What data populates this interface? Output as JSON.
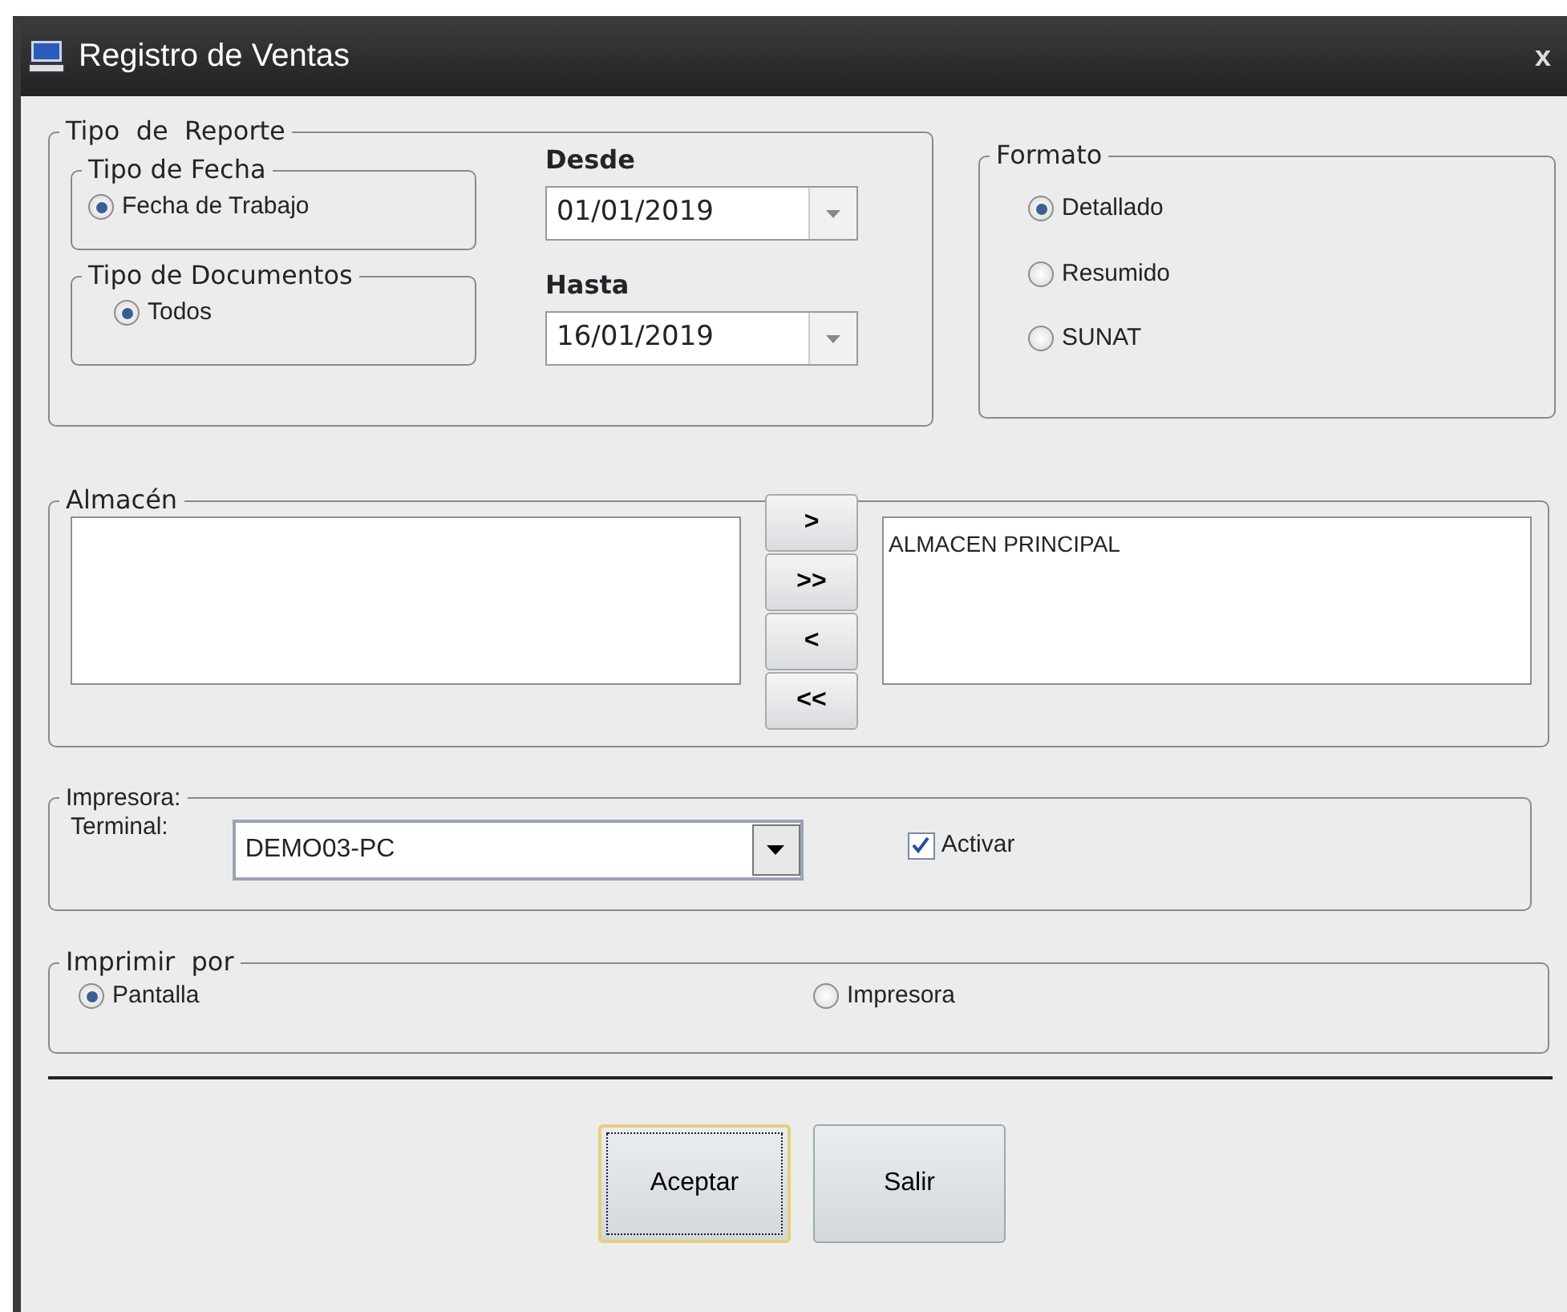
{
  "window": {
    "title": "Registro de Ventas",
    "close": "x"
  },
  "tipo_reporte": {
    "title": "Tipo  de  Reporte",
    "tipo_fecha": {
      "title": "Tipo de Fecha",
      "options": [
        {
          "label": "Fecha de Trabajo",
          "selected": true
        }
      ]
    },
    "tipo_documentos": {
      "title": "Tipo de Documentos",
      "options": [
        {
          "label": "Todos",
          "selected": true
        }
      ]
    },
    "desde": {
      "label": "Desde",
      "value": "01/01/2019"
    },
    "hasta": {
      "label": "Hasta",
      "value": "16/01/2019"
    }
  },
  "formato": {
    "title": "Formato",
    "options": [
      {
        "label": "Detallado",
        "selected": true
      },
      {
        "label": "Resumido",
        "selected": false
      },
      {
        "label": "SUNAT",
        "selected": false
      }
    ]
  },
  "almacen": {
    "title": "Almacén",
    "selected_items": [
      "ALMACEN PRINCIPAL"
    ],
    "buttons": [
      ">",
      ">>",
      "<",
      "<<"
    ]
  },
  "impresora": {
    "title": "Impresora:",
    "terminal_label": "Terminal:",
    "terminal_value": "DEMO03-PC",
    "activar": {
      "label": "Activar",
      "checked": true
    }
  },
  "imprimir_por": {
    "title": "Imprimir  por",
    "options": [
      {
        "label": "Pantalla",
        "selected": true
      },
      {
        "label": "Impresora",
        "selected": false
      }
    ]
  },
  "buttons": [
    {
      "label": "Aceptar",
      "focused": true
    },
    {
      "label": "Salir",
      "focused": false
    }
  ]
}
